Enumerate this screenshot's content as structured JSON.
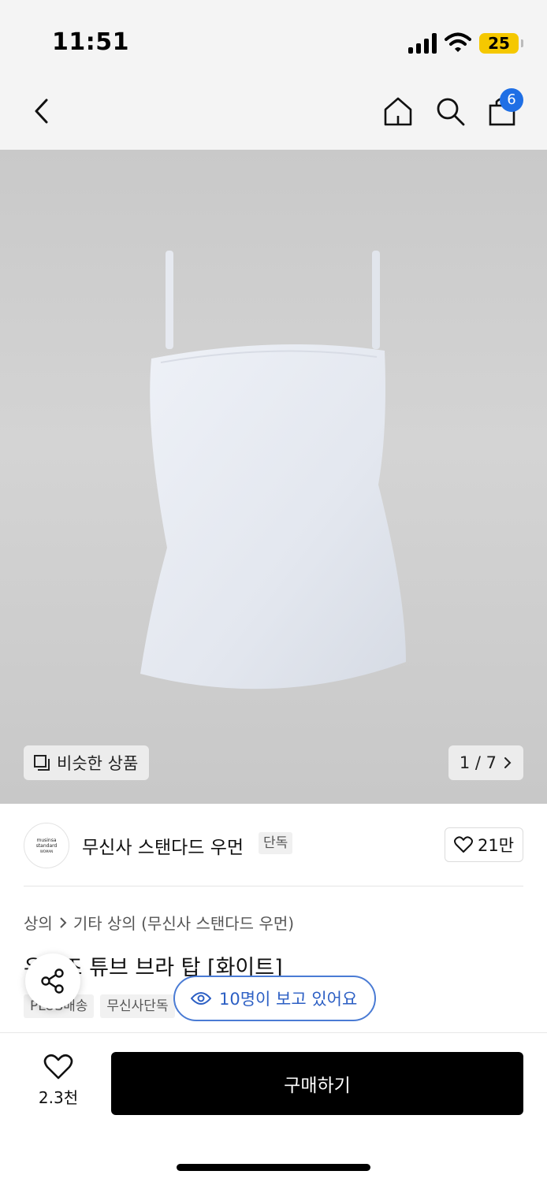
{
  "status_bar": {
    "time": "11:51",
    "battery": "25"
  },
  "nav": {
    "cart_count": "6",
    "icons": [
      "back-arrow-icon",
      "home-icon",
      "search-icon",
      "shopping-bag-icon"
    ]
  },
  "hero": {
    "similar_label": "비슷한 상품",
    "pager": {
      "text": "1 / 7",
      "current": 1,
      "total": 7
    }
  },
  "brand": {
    "logo_lines": [
      "musinsa",
      "standard",
      "WOMAN"
    ],
    "name": "무신사 스탠다드 우먼",
    "tag": "단독",
    "likes": "21만"
  },
  "breadcrumb": {
    "level1": "상의",
    "level2": "기타 상의 (무신사 스탠다드 우먼)"
  },
  "product": {
    "title": "우먼즈 튜브 브라 탑 [화이트]"
  },
  "tags": [
    "PLUS배송",
    "무신사단독"
  ],
  "viewers": "10명이 보고 있어요",
  "bottom": {
    "wish_count": "2.3천",
    "buy_label": "구매하기"
  },
  "colors": {
    "accent": "#1f6fe5",
    "viewers_text": "#2c5fc4",
    "buy_bg": "#000000",
    "hero_bg": "#c9c9c9"
  }
}
